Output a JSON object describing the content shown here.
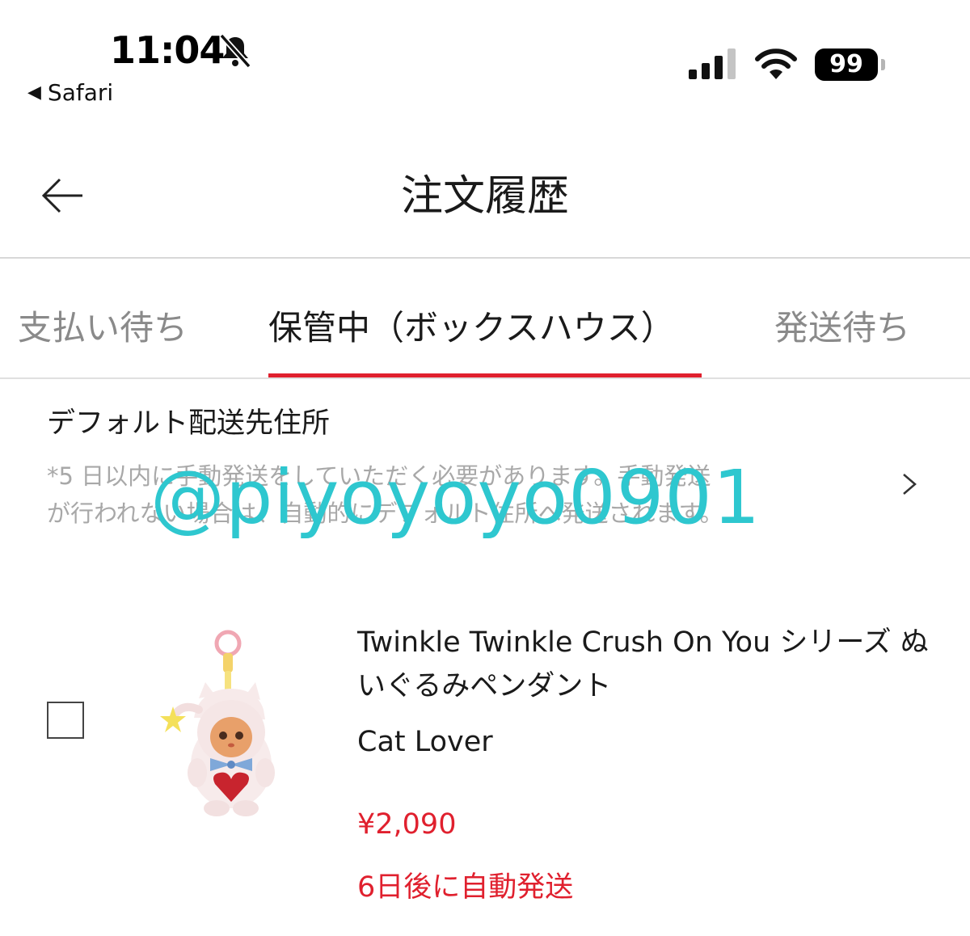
{
  "status_bar": {
    "time": "11:04",
    "back_app": "Safari",
    "battery": "99",
    "bell_icon": "bell-slash-icon",
    "signal_icon": "cellular-signal-icon",
    "wifi_icon": "wifi-icon"
  },
  "header": {
    "title": "注文履歴",
    "back_icon": "arrow-left-icon"
  },
  "tabs": [
    {
      "label": "支払い待ち",
      "active": false
    },
    {
      "label": "保管中（ボックスハウス）",
      "active": true
    },
    {
      "label": "発送待ち",
      "active": false
    }
  ],
  "address": {
    "title": "デフォルト配送先住所",
    "note": "*5 日以内に手動発送をしていただく必要があります。手動発送が行われない場合は、自動的にデフォルト住所へ発送されます。",
    "chevron_icon": "chevron-right-icon"
  },
  "watermark": "@piyoyoyo0901",
  "product": {
    "name": "Twinkle Twinkle Crush On You シリーズ ぬいぐるみペンダント",
    "variant": "Cat Lover",
    "price": "¥2,090",
    "status": "6日後に自動発送",
    "selected": false
  },
  "colors": {
    "accent_red": "#e0202e",
    "watermark": "#2ec7cf",
    "muted_text": "#8a8a8a"
  }
}
